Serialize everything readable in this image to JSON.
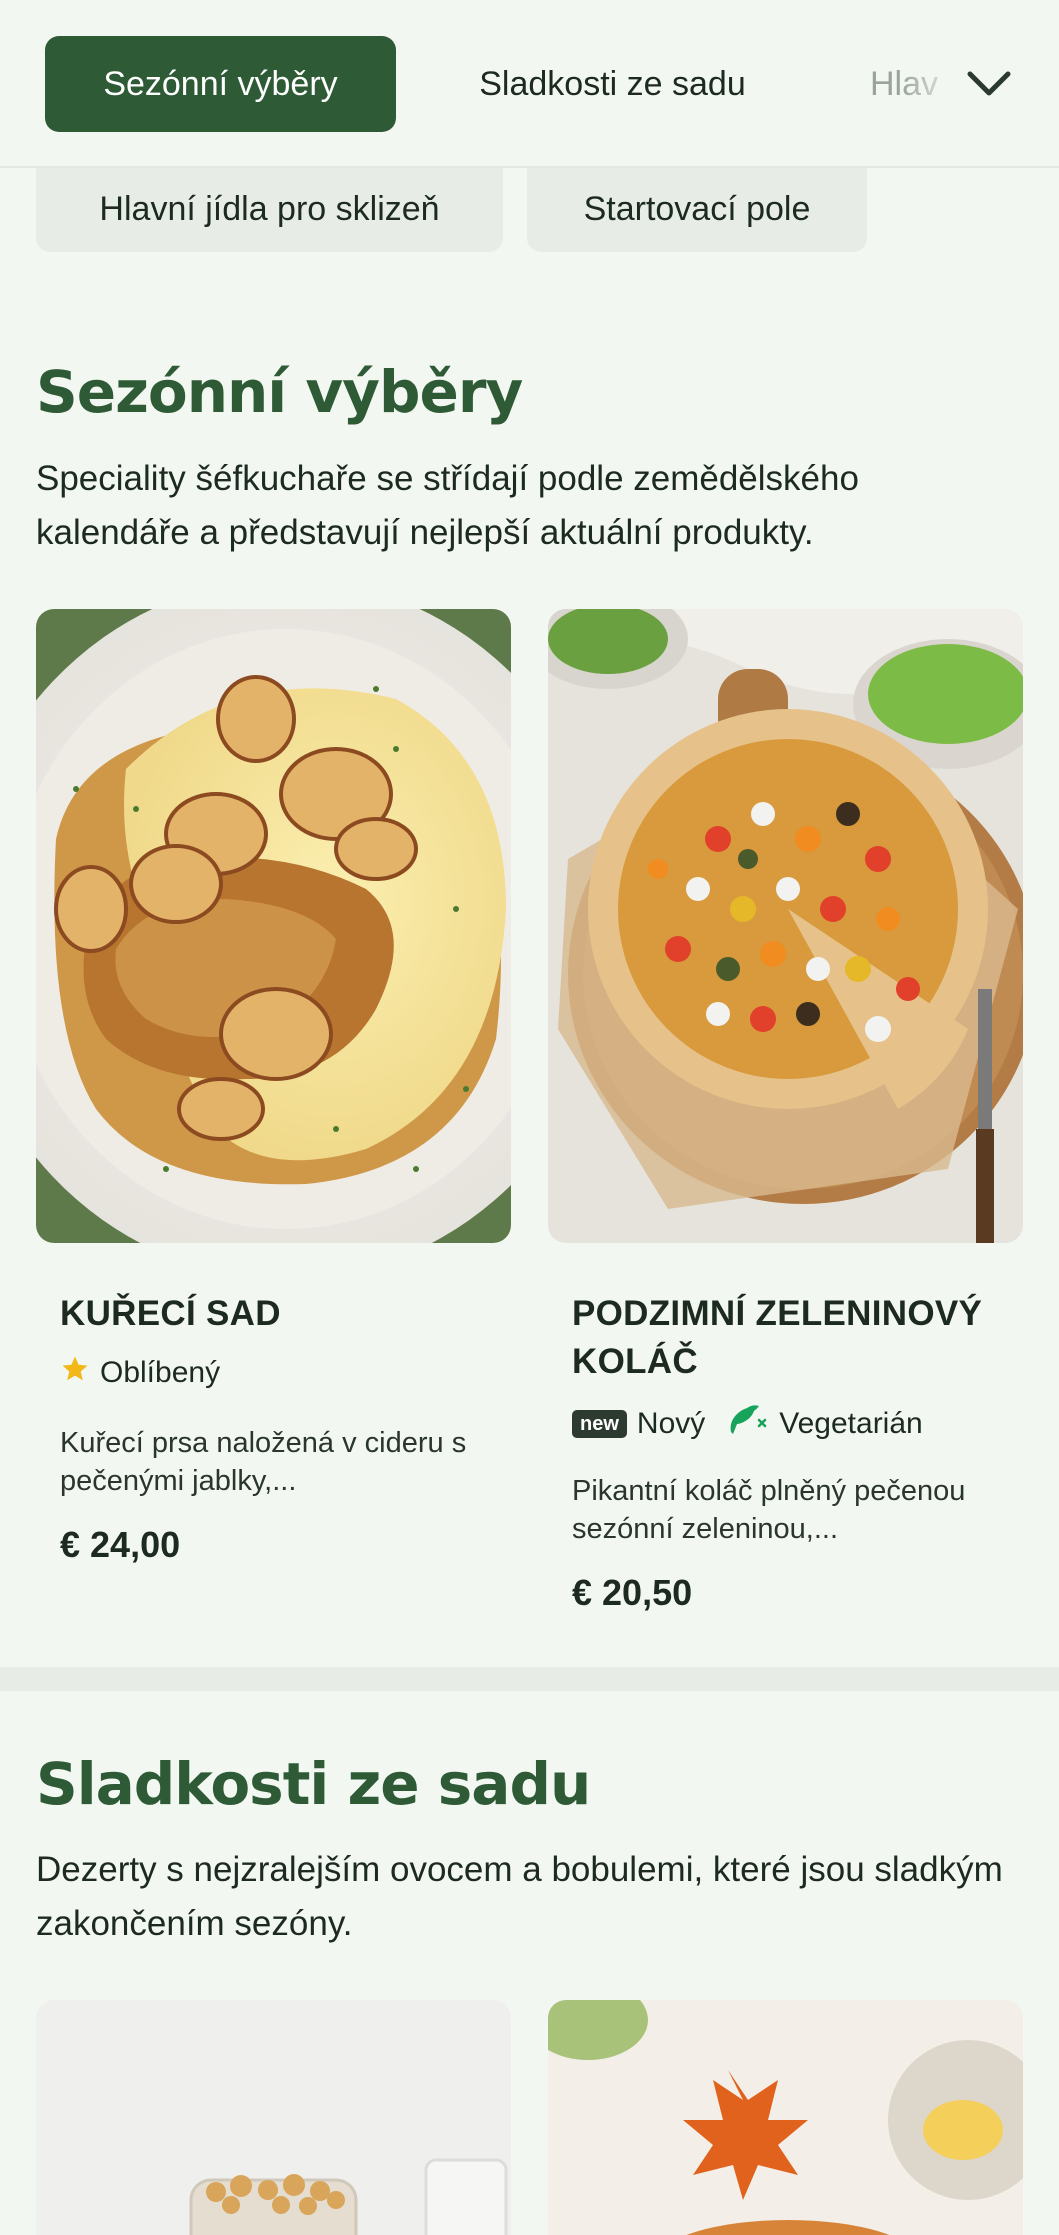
{
  "nav": {
    "tabs": [
      {
        "label": "Sezónní výběry",
        "active": true
      },
      {
        "label": "Sladkosti ze sadu",
        "active": false
      },
      {
        "label": "Hlav",
        "active": false
      }
    ],
    "expand_icon": "chevron-down-icon",
    "chips": [
      {
        "label": "Hlavní jídla pro sklizeň"
      },
      {
        "label": "Startovací pole"
      }
    ]
  },
  "sections": [
    {
      "title": "Sezónní výběry",
      "description": "Speciality šéfkuchaře se střídají podle zemědělského kalendáře a představují nejlepší aktuální produkty.",
      "cards": [
        {
          "image": "roast-chicken-apples-mashed-potatoes",
          "title": "KUŘECÍ SAD",
          "tags": [
            {
              "icon": "star-icon",
              "label": "Oblíbený"
            }
          ],
          "description": "Kuřecí prsa naložená v cideru s pečenými jablky,...",
          "price": "€ 24,00"
        },
        {
          "image": "autumn-vegetable-galette",
          "title": "PODZIMNÍ ZELENINOVÝ KOLÁČ",
          "tags": [
            {
              "icon": "new-badge-icon",
              "badge": "new",
              "label": "Nový"
            },
            {
              "icon": "vegetarian-icon",
              "label": "Vegetarián"
            }
          ],
          "description": "Pikantní koláč plněný pečenou sezónní zeleninou,...",
          "price": "€ 20,50"
        }
      ]
    },
    {
      "title": "Sladkosti ze sadu",
      "description": "Dezerty s nejzralejším ovocem a bobulemi, které jsou sladkým zakončením sezóny.",
      "cards": [
        {
          "image": "dessert-jar-with-nuts"
        },
        {
          "image": "pumpkin-pie-autumn-leaves"
        }
      ]
    }
  ],
  "colors": {
    "accent": "#2e5b36",
    "background": "#f3f7f2",
    "chip": "#e7ede6",
    "star": "#f2b818",
    "vegetarian": "#17a35a"
  }
}
